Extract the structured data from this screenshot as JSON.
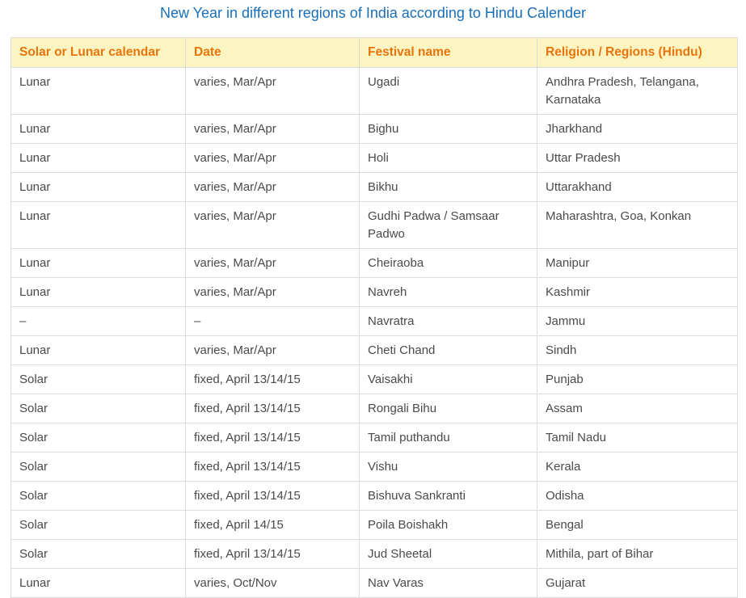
{
  "title": "New Year in different regions of India according to Hindu Calender",
  "table": {
    "headers": [
      "Solar or Lunar calendar",
      "Date",
      "Festival name",
      "Religion / Regions (Hindu)"
    ],
    "rows": [
      [
        "Lunar",
        "varies, Mar/Apr",
        "Ugadi",
        "Andhra Pradesh, Telangana, Karnataka"
      ],
      [
        "Lunar",
        "varies, Mar/Apr",
        "Bighu",
        "Jharkhand"
      ],
      [
        "Lunar",
        "varies, Mar/Apr",
        "Holi",
        "Uttar Pradesh"
      ],
      [
        "Lunar",
        "varies, Mar/Apr",
        "Bikhu",
        "Uttarakhand"
      ],
      [
        "Lunar",
        "varies, Mar/Apr",
        "Gudhi Padwa / Samsaar Padwo",
        "Maharashtra, Goa, Konkan"
      ],
      [
        "Lunar",
        "varies, Mar/Apr",
        "Cheiraoba",
        "Manipur"
      ],
      [
        "Lunar",
        "varies, Mar/Apr",
        "Navreh",
        "Kashmir"
      ],
      [
        "–",
        "–",
        "Navratra",
        "Jammu"
      ],
      [
        "Lunar",
        "varies, Mar/Apr",
        "Cheti Chand",
        "Sindh"
      ],
      [
        "Solar",
        "fixed, April 13/14/15",
        "Vaisakhi",
        "Punjab"
      ],
      [
        "Solar",
        "fixed, April 13/14/15",
        "Rongali Bihu",
        "Assam"
      ],
      [
        "Solar",
        "fixed, April 13/14/15",
        "Tamil puthandu",
        "Tamil Nadu"
      ],
      [
        "Solar",
        "fixed, April 13/14/15",
        "Vishu",
        "Kerala"
      ],
      [
        "Solar",
        "fixed, April 13/14/15",
        "Bishuva Sankranti",
        "Odisha"
      ],
      [
        "Solar",
        "fixed, April 14/15",
        "Poila Boishakh",
        "Bengal"
      ],
      [
        "Solar",
        "fixed, April 13/14/15",
        "Jud Sheetal",
        "Mithila, part of Bihar"
      ],
      [
        "Lunar",
        "varies, Oct/Nov",
        "Nav Varas",
        "Gujarat"
      ]
    ]
  },
  "colors": {
    "title": "#1a6fb5",
    "header_text": "#e8740c",
    "header_bg": "#fdf5c1",
    "cell_text": "#4a4a4a",
    "border": "#dcdcdc"
  }
}
